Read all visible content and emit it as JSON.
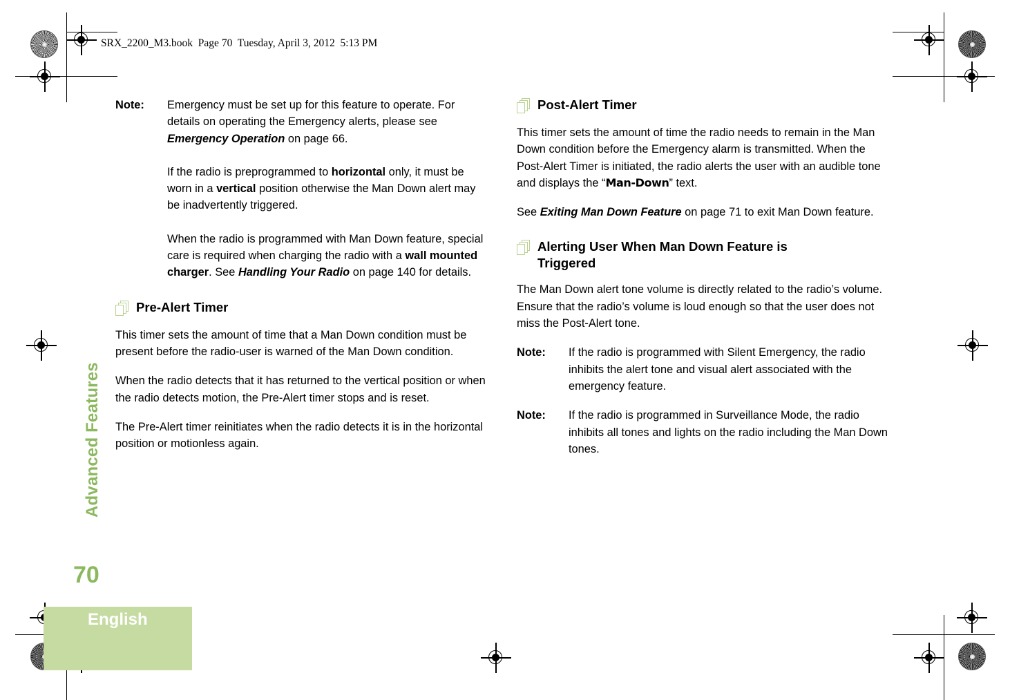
{
  "document": {
    "file_header": "SRX_2200_M3.book  Page 70  Tuesday, April 3, 2012  5:13 PM",
    "chapter_tab": "Advanced Features",
    "page_number": "70",
    "language": "English"
  },
  "colors": {
    "sidebar_green": "#8cb860",
    "block_green": "#c6dba2",
    "icon_green": "#b9d191"
  },
  "left_column": {
    "note1": {
      "label": "Note:",
      "body_part1": "Emergency must be set up for this feature to operate. For details on operating the Emergency alerts, please see ",
      "body_emph": "Emergency Operation",
      "body_part2": " on page 66."
    },
    "note1_cont": {
      "part1": "If the radio is preprogrammed to ",
      "bold1": "horizontal",
      "part2": " only, it must be worn in a ",
      "bold2": "vertical",
      "part3": " position otherwise the Man Down alert may be inadvertently triggered."
    },
    "note1_cont2": {
      "part1": "When the radio is programmed with Man Down feature, special care is required when charging the radio with a ",
      "bold1": "wall mounted charger",
      "part2": ". See ",
      "emph1": "Handling Your Radio",
      "part3": " on page 140 for details."
    },
    "section": {
      "title": "Pre-Alert Timer",
      "icon": "stacked-pages-icon"
    },
    "paragraphs": [
      "This timer sets the amount of time that a Man Down condition must be present before the radio-user is warned of the Man Down condition.",
      "When the radio detects that it has returned to the vertical position or when the radio detects motion, the Pre-Alert timer stops and is reset.",
      "The Pre-Alert timer reinitiates when the radio detects it is in the horizontal position or motionless again."
    ]
  },
  "right_column": {
    "section1": {
      "title": "Post-Alert Timer",
      "icon": "stacked-pages-icon"
    },
    "para1": {
      "part1": "This timer sets the amount of time the radio needs to remain in the Man Down condition before the Emergency alarm is transmitted. When the Post-Alert Timer is initiated, the radio alerts the user with an audible tone and displays the “",
      "display": "Man-Down",
      "part2": "” text."
    },
    "para2": {
      "part1": "See ",
      "emph1": "Exiting Man Down Feature",
      "part2": " on page 71 to exit Man Down feature."
    },
    "section2": {
      "title": "Alerting User When Man Down Feature is Triggered",
      "icon": "stacked-pages-icon"
    },
    "para3": "The Man Down alert tone volume is directly related to the radio’s volume. Ensure that the radio’s volume is loud enough so that the user does not miss the Post-Alert tone.",
    "note1": {
      "label": "Note:",
      "body": "If the radio is programmed with Silent Emergency, the radio inhibits the alert tone and visual alert associated with the emergency feature."
    },
    "note2": {
      "label": "Note:",
      "body": "If the radio is programmed in Surveillance Mode, the radio inhibits all tones and lights on the radio including the Man Down tones."
    }
  }
}
